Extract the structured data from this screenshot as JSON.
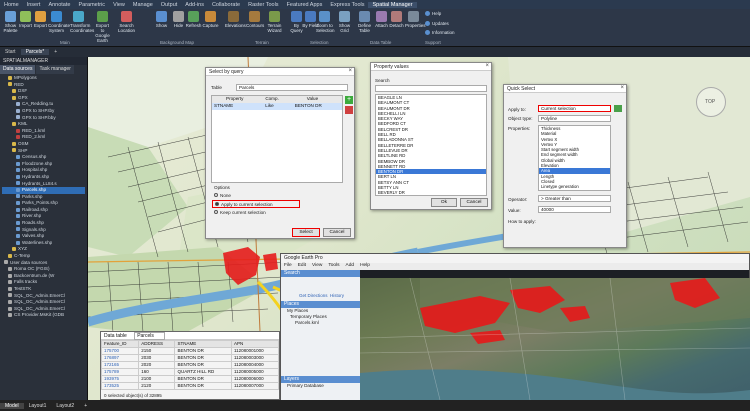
{
  "menu": [
    "Home",
    "Insert",
    "Annotate",
    "Parametric",
    "View",
    "Manage",
    "Output",
    "Add-ins",
    "Collaborate",
    "Raster Tools",
    "Featured Apps",
    "Express Tools",
    "Spatial Manager"
  ],
  "menu_active_index": 12,
  "ribbon": {
    "buttons": [
      {
        "label": "Show Palette",
        "color": "#6aa0d8"
      },
      {
        "label": "Import",
        "color": "#8fbf5a"
      },
      {
        "label": "Export",
        "color": "#e0a040"
      },
      {
        "label": "Coordinate System",
        "color": "#3b8bd1"
      },
      {
        "label": "Transform Coordinates",
        "color": "#4aa8c9"
      },
      {
        "label": "Export to Google Earth",
        "color": "#5c9f4a"
      },
      {
        "label": "Search Location",
        "color": "#d35d5d"
      },
      {
        "label": "Show",
        "color": "#5a8fd0"
      },
      {
        "label": "Hide",
        "color": "#a0a0a0"
      },
      {
        "label": "Refresh",
        "color": "#58a05a"
      },
      {
        "label": "Capture",
        "color": "#c98a3a"
      },
      {
        "label": "Elevations",
        "color": "#8a6a3a"
      },
      {
        "label": "Contours",
        "color": "#a57a3e"
      },
      {
        "label": "Terrain Wizard",
        "color": "#7a9a4a"
      },
      {
        "label": "By Query",
        "color": "#4a7ac0"
      },
      {
        "label": "By Field",
        "color": "#4a7ac0"
      },
      {
        "label": "Zoom to Selection",
        "color": "#5a90c8"
      },
      {
        "label": "Show Grid",
        "color": "#7aa0c0"
      },
      {
        "label": "Define Table",
        "color": "#6a8ab0"
      },
      {
        "label": "Attach",
        "color": "#9a7ab0"
      },
      {
        "label": "Detach",
        "color": "#b07a7a"
      },
      {
        "label": "Properties",
        "color": "#7a8a9a"
      },
      {
        "label": "Help",
        "color": "#5a90d0"
      },
      {
        "label": "Updates",
        "color": "#5a90d0"
      },
      {
        "label": "Information",
        "color": "#5a90d0"
      }
    ],
    "groups": [
      "Main",
      "Background Map",
      "Terrain",
      "Selection",
      "Data Table",
      "Support"
    ]
  },
  "doc_tabs": [
    "Start",
    "Parcels*",
    "+"
  ],
  "panel": {
    "title": "SPATIALMANAGER",
    "tabs": [
      "Data sources",
      "Task manager"
    ],
    "tree": [
      {
        "label": "MPolygons",
        "color": "#d8b84a"
      },
      {
        "label": "RED",
        "color": "#d8b84a"
      },
      {
        "label": "DXF",
        "color": "#d8b84a"
      },
      {
        "label": "GPX",
        "color": "#d8b84a"
      },
      {
        "label": "CA_Redding.tu",
        "color": "#9ab0d0"
      },
      {
        "label": "GPX to SHP.tby",
        "color": "#9ab0d0"
      },
      {
        "label": "GPX to SHP.bby",
        "color": "#9ab0d0"
      },
      {
        "label": "KML",
        "color": "#d8b84a"
      },
      {
        "label": "RED_1.kml",
        "color": "#c04040"
      },
      {
        "label": "RED_2.kml",
        "color": "#c04040"
      },
      {
        "label": "OSM",
        "color": "#d8b84a"
      },
      {
        "label": "SHP",
        "color": "#d8b84a"
      },
      {
        "label": "Census.shp",
        "color": "#6a9ad0"
      },
      {
        "label": "Floodzone.shp",
        "color": "#6a9ad0"
      },
      {
        "label": "Hospital.shp",
        "color": "#6a9ad0"
      },
      {
        "label": "Hydrants.shp",
        "color": "#6a9ad0"
      },
      {
        "label": "Hydrants_LL84.s",
        "color": "#6a9ad0"
      },
      {
        "label": "Parcels.shp",
        "color": "#6a9ad0",
        "selected": true
      },
      {
        "label": "Parks.shp",
        "color": "#6a9ad0"
      },
      {
        "label": "Parks_Points.shp",
        "color": "#6a9ad0"
      },
      {
        "label": "Railroad.shp",
        "color": "#6a9ad0"
      },
      {
        "label": "River.shp",
        "color": "#6a9ad0"
      },
      {
        "label": "Roads.shp",
        "color": "#6a9ad0"
      },
      {
        "label": "Signals.shp",
        "color": "#6a9ad0"
      },
      {
        "label": "Valves.shp",
        "color": "#6a9ad0"
      },
      {
        "label": "Waterlines.shp",
        "color": "#6a9ad0"
      },
      {
        "label": "XYZ",
        "color": "#d8b84a"
      },
      {
        "label": "C-Temp",
        "color": "#d8b84a"
      },
      {
        "label": "User data sources",
        "color": "#aaa"
      },
      {
        "label": "Roma OC (FGIS)",
        "color": "#aaa"
      },
      {
        "label": "Backcentrum.de (W",
        "color": "#aaa"
      },
      {
        "label": "Falls tracks",
        "color": "#aaa"
      },
      {
        "label": "TestSTK",
        "color": "#aaa"
      },
      {
        "label": "SQL_OC_Admin.EmerCl",
        "color": "#aaa"
      },
      {
        "label": "SQL_OC_Admin.EmerCl",
        "color": "#aaa"
      },
      {
        "label": "SQL_OC_Admin.EmerCl",
        "color": "#aaa"
      },
      {
        "label": "CS Provider.MsKit (GDB",
        "color": "#aaa"
      }
    ]
  },
  "query_dialog": {
    "title": "Select by query",
    "table_label": "Table",
    "table_value": "Parcels",
    "columns": [
      "Property",
      "Comp.",
      "Value"
    ],
    "row": {
      "property": "STNAME",
      "comp": "Like",
      "value": "BENTON DR"
    },
    "options_label": "Options",
    "options": [
      "None",
      "Apply to current selection",
      "Keep current selection"
    ],
    "option_selected": 1,
    "select_btn": "Select",
    "cancel_btn": "Cancel"
  },
  "property_dialog": {
    "title": "Property values",
    "search_label": "Search",
    "values": [
      "BEAGLE LN",
      "BEAUMONT CT",
      "BEAUMONT DR",
      "BECHELLI LN",
      "BECKY WAY",
      "BEDFORD CT",
      "BELCREST DR",
      "BELL RD",
      "BELLADONNA ST",
      "BELLETERRE DR",
      "BELLEVUE DR",
      "BELTLINE RD",
      "BEMBOW DR",
      "BENNETT RD",
      "BENTON DR",
      "BERT LN",
      "BETSY ANN CT",
      "BETTY LN",
      "BEVERLY DR",
      "BIANCA WAY",
      "BIDWELL RD"
    ],
    "selected": "BENTON DR",
    "ok_btn": "Ok",
    "cancel_btn": "Cancel"
  },
  "quick_select": {
    "title": "Quick Select",
    "apply_to_label": "Apply to:",
    "apply_to_value": "Current selection",
    "object_type_label": "Object type:",
    "object_type_value": "Polyline",
    "properties_label": "Properties:",
    "properties": [
      "Thickness",
      "Material",
      "Vertex X",
      "Vertex Y",
      "Start segment width",
      "End segment width",
      "Global width",
      "Elevation",
      "Area",
      "Length",
      "Closed",
      "Linetype generation"
    ],
    "property_selected": "Area",
    "operator_label": "Operator:",
    "operator_value": "> Greater than",
    "value_label": "Value:",
    "value_value": "40000",
    "how_label": "How to apply:"
  },
  "google_earth": {
    "title": "Google Earth Pro",
    "menu": [
      "File",
      "Edit",
      "View",
      "Tools",
      "Add",
      "Help"
    ],
    "search_label": "Search",
    "get_directions": "Get Directions",
    "history": "History",
    "places_label": "Places",
    "places": [
      "My Places",
      "Temporary Places",
      "Parcels.kml"
    ],
    "layers_label": "Layers",
    "layers_item": "Primary Database"
  },
  "data_table": {
    "title": "Data table",
    "table_name": "Parcels",
    "columns": [
      "Feature_ID",
      "ADDRESS",
      "STNAME",
      "APN"
    ],
    "rows": [
      [
        "175700",
        "2150",
        "BENTON DR",
        "112080001000"
      ],
      [
        "176897",
        "2030",
        "BENTON DR",
        "112080003000"
      ],
      [
        "172165",
        "2020",
        "BENTON DR",
        "112080004000"
      ],
      [
        "175789",
        "160",
        "QUARTZ HILL RD",
        "112080005000"
      ],
      [
        "193975",
        "2100",
        "BENTON DR",
        "112080006000"
      ],
      [
        "173525",
        "2120",
        "BENTON DR",
        "112080007000"
      ]
    ],
    "status": "0 selected object(s) of 32895"
  },
  "map_labels": {
    "top": "TOP"
  },
  "layout_tabs": [
    "Model",
    "Layout1",
    "Layout2",
    "+"
  ]
}
